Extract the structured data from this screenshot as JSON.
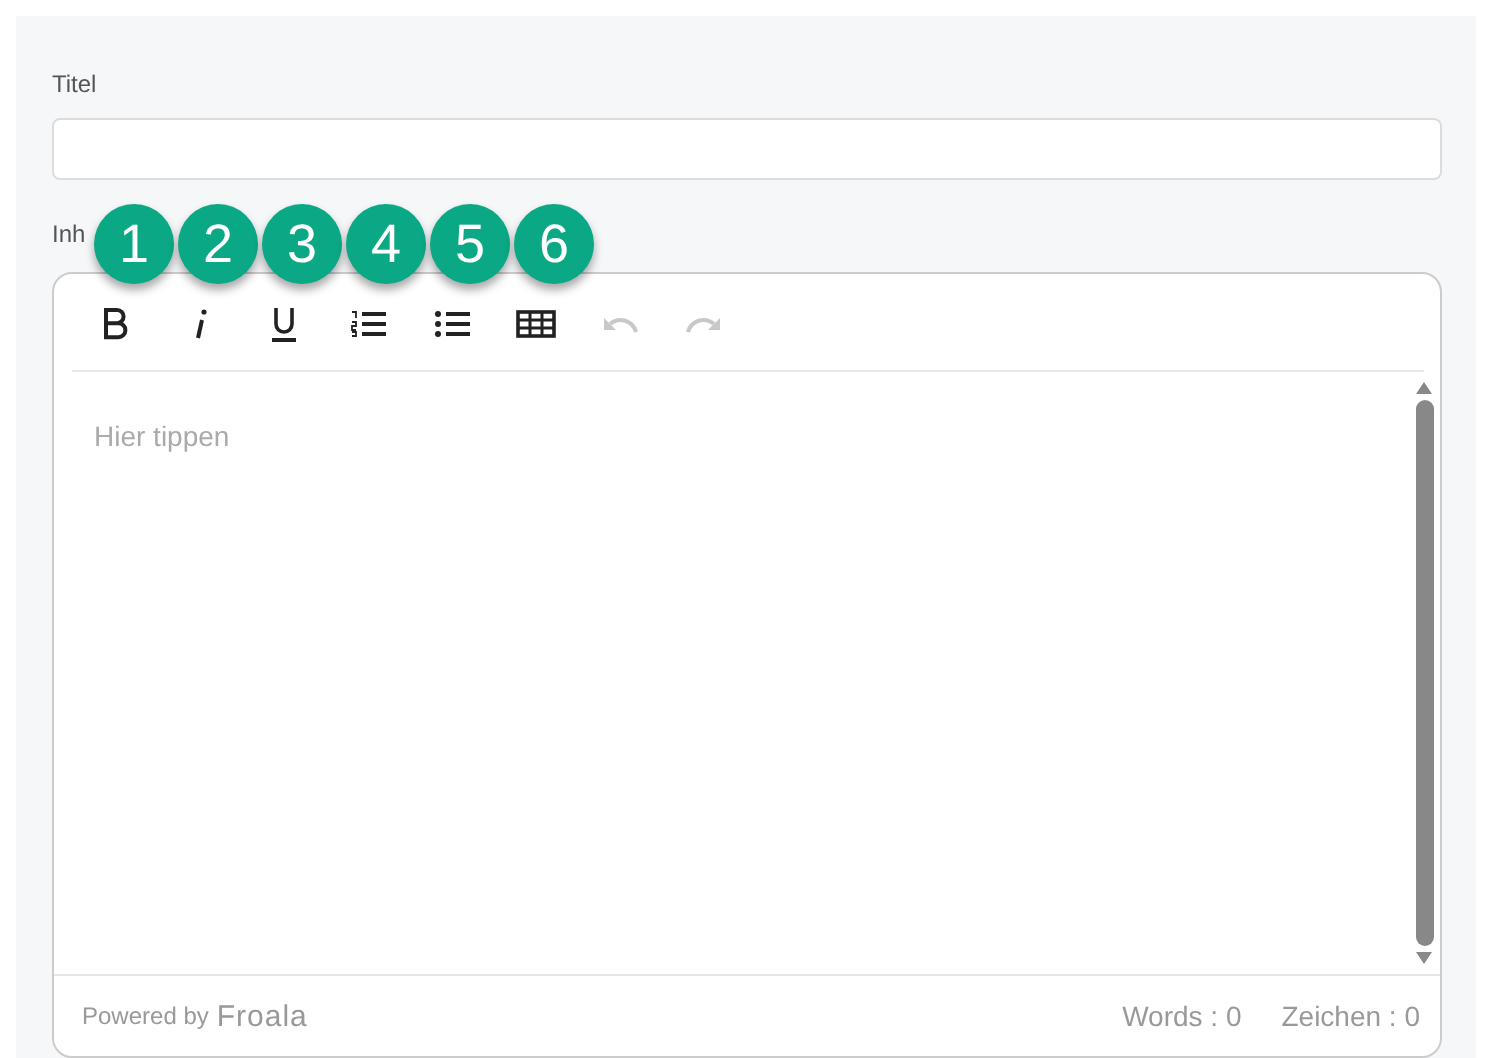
{
  "title_field": {
    "label": "Titel"
  },
  "content_field": {
    "label": "Inh"
  },
  "toolbar": [
    {
      "kind": "bold",
      "disabled": false
    },
    {
      "kind": "italic",
      "disabled": false
    },
    {
      "kind": "underline",
      "disabled": false
    },
    {
      "kind": "ordered-list",
      "disabled": false
    },
    {
      "kind": "bullet-list",
      "disabled": false
    },
    {
      "kind": "table",
      "disabled": false
    },
    {
      "kind": "undo",
      "disabled": true
    },
    {
      "kind": "redo",
      "disabled": true
    }
  ],
  "callouts": [
    "1",
    "2",
    "3",
    "4",
    "5",
    "6"
  ],
  "editor": {
    "placeholder": "Hier tippen"
  },
  "footer": {
    "powered_by": "Powered by",
    "brand": "Froala",
    "words": "Words : 0",
    "chars": "Zeichen : 0"
  }
}
